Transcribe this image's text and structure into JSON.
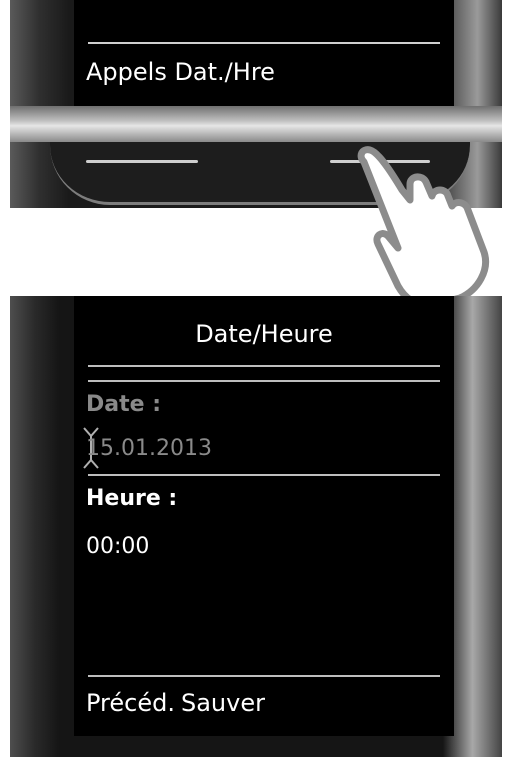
{
  "top_screen": {
    "softkey_label": "Appels Dat./Hre"
  },
  "bottom_screen": {
    "title": "Date/Heure",
    "date_label": "Date :",
    "date_value": "15.01.2013",
    "time_label": "Heure :",
    "time_value": "00:00",
    "softkey_left": "Précéd.",
    "softkey_right": "Sauver"
  },
  "icons": {
    "pointer": "hand-pointer-icon",
    "cursor": "text-cursor-icon"
  }
}
